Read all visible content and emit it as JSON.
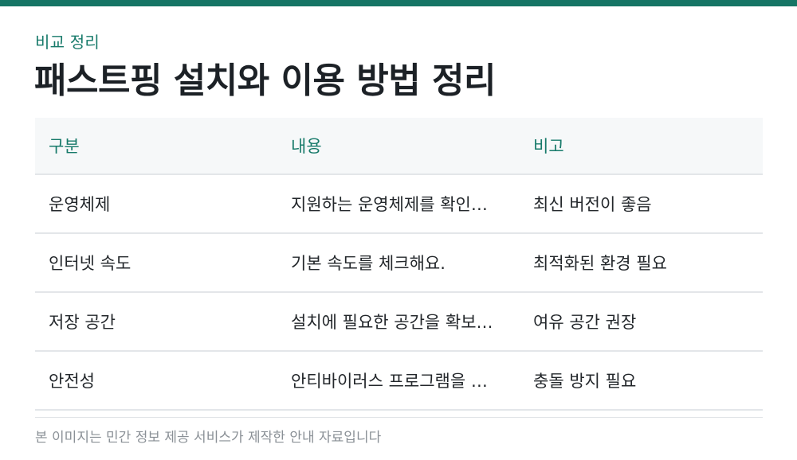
{
  "header": {
    "eyebrow": "비교 정리",
    "title": "패스트핑 설치와 이용 방법 정리"
  },
  "table": {
    "columns": [
      "구분",
      "내용",
      "비고"
    ],
    "rows": [
      [
        "운영체제",
        "지원하는 운영체제를 확인…",
        "최신 버전이 좋음"
      ],
      [
        "인터넷 속도",
        "기본 속도를 체크해요.",
        "최적화된 환경 필요"
      ],
      [
        "저장 공간",
        "설치에 필요한 공간을 확보…",
        "여유 공간 권장"
      ],
      [
        "안전성",
        "안티바이러스 프로그램을 …",
        "충돌 방지 필요"
      ]
    ]
  },
  "footer": {
    "note": "본 이미지는 민간 정보 제공 서비스가 제작한 안내 자료입니다"
  },
  "colors": {
    "accent": "#167565",
    "header_bg": "#f6f8f9",
    "divider": "#e3e6e9"
  }
}
